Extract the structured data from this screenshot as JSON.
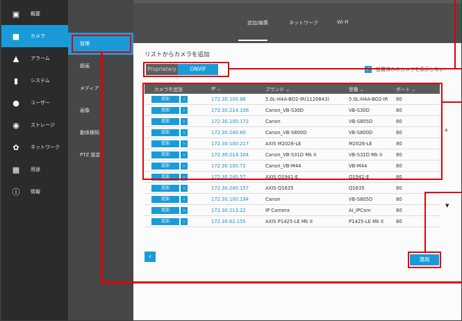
{
  "sidebar": {
    "items": [
      {
        "icon": "dashboard-icon",
        "glyph": "▣",
        "label": "概要",
        "active": false
      },
      {
        "icon": "camera-icon",
        "glyph": "■",
        "label": "カメラ",
        "active": true
      },
      {
        "icon": "alarm-icon",
        "glyph": "▲",
        "label": "アラーム",
        "active": false
      },
      {
        "icon": "system-icon",
        "glyph": "▮",
        "label": "システム",
        "active": false
      },
      {
        "icon": "user-icon",
        "glyph": "●",
        "label": "ユーザー",
        "active": false
      },
      {
        "icon": "storage-icon",
        "glyph": "◉",
        "label": "ストレージ",
        "active": false
      },
      {
        "icon": "network-icon",
        "glyph": "✿",
        "label": "ネットワーク",
        "active": false
      },
      {
        "icon": "apps-icon",
        "glyph": "▦",
        "label": "用途",
        "active": false
      },
      {
        "icon": "info-icon",
        "glyph": "ⓘ",
        "label": "情報",
        "active": false
      }
    ]
  },
  "submenu": {
    "items": [
      {
        "label": "管理",
        "active": true
      },
      {
        "label": "録画",
        "active": false
      },
      {
        "label": "メディア",
        "active": false
      },
      {
        "label": "画像",
        "active": false
      },
      {
        "label": "動体検知",
        "active": false
      },
      {
        "label": "PTZ 設定",
        "active": false
      }
    ]
  },
  "tabs": {
    "add_edit": "追加/編集",
    "network": "ネットワーク",
    "wifi": "Wi-Fi"
  },
  "main": {
    "title": "リストからカメラを追加",
    "segment": {
      "proprietary": "Proprietary",
      "onvif": "ONVIF"
    },
    "show_added_label": "設置済みのカメラを表示しない",
    "show_added_check": "✓"
  },
  "table": {
    "headers": {
      "add": "カメラを追加",
      "ip": "IP ⌄",
      "brand": "ブランド ⌄",
      "model": "型番 ⌄",
      "port": "ポート ⌄"
    },
    "add_label": "追加",
    "arrow": "›",
    "rows": [
      {
        "ip": "172.30.100.86",
        "brand": "5.0L-H4A-BO2-IR(1120843)",
        "model": "5.0L-H4A-BO2-IR",
        "port": "80"
      },
      {
        "ip": "172.30.214.106",
        "brand": "Canon_VB-S30D",
        "model": "VB-S30D",
        "port": "80"
      },
      {
        "ip": "172.30.100.172",
        "brand": "Canon",
        "model": "VB-S805D",
        "port": "80"
      },
      {
        "ip": "172.30.240.60",
        "brand": "Canon_VB-S800D",
        "model": "VB-S800D",
        "port": "80"
      },
      {
        "ip": "172.30.100.217",
        "brand": "AXIS M2026-LE",
        "model": "M2026-LE",
        "port": "80"
      },
      {
        "ip": "172.30.214.104",
        "brand": "Canon_VB-S31D Mk II",
        "model": "VB-S31D Mk II",
        "port": "80"
      },
      {
        "ip": "172.30.100.72",
        "brand": "Canon_VB-M44",
        "model": "VB-M44",
        "port": "80"
      },
      {
        "ip": "172.30.240.57",
        "brand": "AXIS Q1941-E",
        "model": "Q1941-E",
        "port": "80"
      },
      {
        "ip": "172.30.240.157",
        "brand": "AXIS Q1635",
        "model": "Q1635",
        "port": "80"
      },
      {
        "ip": "172.30.100.194",
        "brand": "Canon",
        "model": "VB-S805D",
        "port": "80"
      },
      {
        "ip": "172.30.213.22",
        "brand": "IP Camera",
        "model": "AI_IPCam",
        "port": "80"
      },
      {
        "ip": "172.30.62.155",
        "brand": "AXIS P1425-LE Mk II",
        "model": "P1425-LE Mk II",
        "port": "80"
      }
    ]
  },
  "pager": {
    "prev": "‹"
  },
  "apply_label": "適用",
  "scroll": {
    "up": "▲",
    "down": "▼"
  }
}
